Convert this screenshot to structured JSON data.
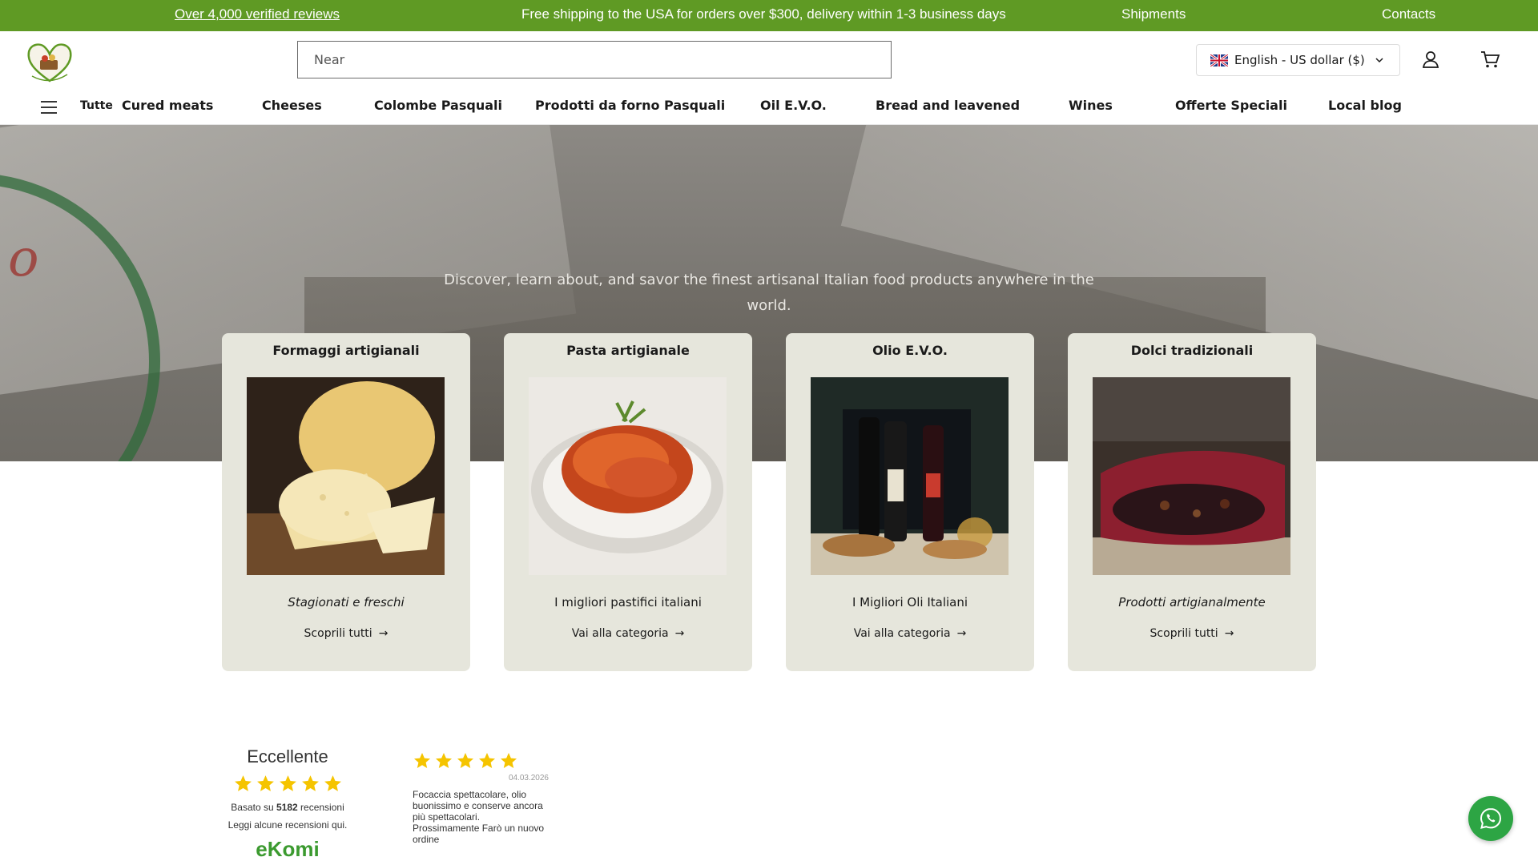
{
  "announcement": {
    "reviews": "Over 4,000 verified reviews",
    "shipping": "Free shipping to the USA for orders over $300, delivery within 1-3 business days",
    "shipments": "Shipments",
    "contacts": "Contacts"
  },
  "header": {
    "search_placeholder": "Near",
    "locale": "English - US dollar ($)",
    "brand_color": "#5f9a24"
  },
  "nav": {
    "all": "Tutte",
    "items": [
      "Cured meats",
      "Cheeses",
      "Colombe Pasquali",
      "Prodotti da forno Pasquali",
      "Oil E.V.O.",
      "Bread and leavened",
      "Wines",
      "Offerte Speciali",
      "Local blog"
    ]
  },
  "hero": {
    "text": "Discover, learn about, and savor the finest artisanal Italian food products anywhere in the world."
  },
  "categories": [
    {
      "title": "Formaggi artigianali",
      "subtitle": "Stagionati e freschi",
      "link": "Scoprili tutti"
    },
    {
      "title": "Pasta artigianale",
      "subtitle": "I migliori pastifici italiani",
      "link": "Vai alla categoria"
    },
    {
      "title": "Olio E.V.O.",
      "subtitle": "I Migliori Oli Italiani",
      "link": "Vai alla categoria"
    },
    {
      "title": "Dolci tradizionali",
      "subtitle": "Prodotti artigianalmente",
      "link": "Scoprili tutti"
    }
  ],
  "ekomi": {
    "rating_label": "Eccellente",
    "based_prefix": "Basato su",
    "count": "5182",
    "based_suffix": "recensioni",
    "read": "Leggi alcune recensioni qui.",
    "brand": "eKomi",
    "stars": 5
  },
  "review": {
    "stars": 5,
    "date": "04.03.2026",
    "text": "Focaccia spettacolare, olio buonissimo e conserve ancora più spettacolari. Prossimamente Farò un nuovo ordine"
  },
  "colors": {
    "star": "#f5c400",
    "card_bg": "#e6e6dc",
    "whatsapp": "#2da544"
  }
}
